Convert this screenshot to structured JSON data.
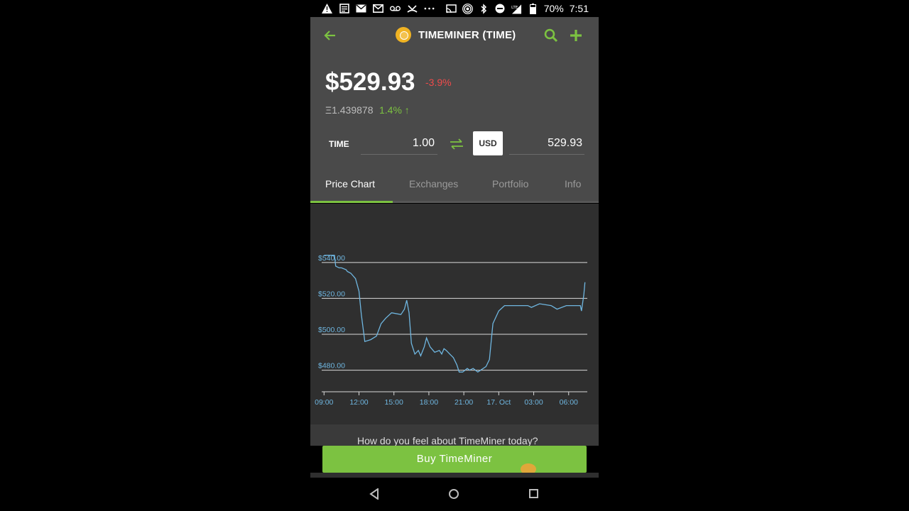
{
  "status_bar": {
    "battery": "70%",
    "time": "7:51",
    "network": "LTE"
  },
  "header": {
    "title": "TIMEMINER (TIME)"
  },
  "price": {
    "value": "$529.93",
    "change": "-3.9%",
    "eth_value": "Ξ1.439878",
    "eth_change": "1.4% ↑"
  },
  "converter": {
    "coin_label": "TIME",
    "amount": "1.00",
    "currency": "USD",
    "result": "529.93"
  },
  "tabs": [
    {
      "label": "Price Chart",
      "active": true
    },
    {
      "label": "Exchanges",
      "active": false
    },
    {
      "label": "Portfolio",
      "active": false
    },
    {
      "label": "Info",
      "active": false
    }
  ],
  "chart_data": {
    "type": "line",
    "title": "",
    "xlabel": "",
    "ylabel": "",
    "x_tick_labels": [
      "09:00",
      "12:00",
      "15:00",
      "18:00",
      "21:00",
      "17. Oct",
      "03:00",
      "06:00"
    ],
    "y_tick_labels": [
      "$540.00",
      "$520.00",
      "$500.00",
      "$480.00"
    ],
    "y_ticks": [
      540,
      520,
      500,
      480
    ],
    "ylim": [
      468,
      551
    ],
    "xlim_hours": [
      8.8,
      31.6
    ],
    "series": [
      {
        "name": "",
        "x": [
          9.0,
          9.9,
          10.0,
          10.3,
          10.5,
          10.9,
          11.0,
          11.3,
          11.7,
          12.0,
          12.2,
          12.5,
          13.0,
          13.5,
          13.9,
          14.3,
          14.8,
          15.6,
          15.7,
          15.9,
          16.1,
          16.3,
          16.5,
          16.8,
          17.1,
          17.3,
          17.6,
          17.8,
          18.1,
          18.5,
          18.9,
          19.1,
          19.3,
          19.5,
          19.8,
          20.1,
          20.4,
          20.6,
          20.9,
          21.3,
          21.5,
          21.8,
          22.0,
          22.2,
          22.9,
          23.2,
          23.5,
          24.0,
          24.5,
          25.5,
          26.5,
          26.8,
          27.5,
          28.5,
          29.0,
          29.8,
          30.5,
          31.0,
          31.1,
          31.3,
          31.4
        ],
        "y": [
          544,
          544,
          538,
          537,
          537,
          536,
          535,
          534,
          531,
          524,
          511,
          496,
          497,
          499,
          506,
          509,
          512,
          511,
          512,
          514,
          519,
          512,
          495,
          489,
          491,
          488,
          493,
          498,
          493,
          490,
          491,
          489,
          492,
          491,
          489,
          487,
          483,
          479,
          479,
          481,
          480,
          481,
          480,
          479,
          482,
          486,
          506,
          513,
          516,
          516,
          516,
          515,
          517,
          516,
          514,
          516,
          516,
          516,
          513,
          522,
          529
        ]
      }
    ],
    "grid": true,
    "line_color": "#6fb6e0"
  },
  "partial_text": "How do you feel about TimeMiner today?",
  "buy_button": "Buy TimeMiner",
  "colors": {
    "accent": "#7cc241",
    "negative": "#ef4a4a",
    "header_bg": "#4a4a4a",
    "chart_bg": "#2f2f2f",
    "chart_line": "#6fb6e0"
  }
}
